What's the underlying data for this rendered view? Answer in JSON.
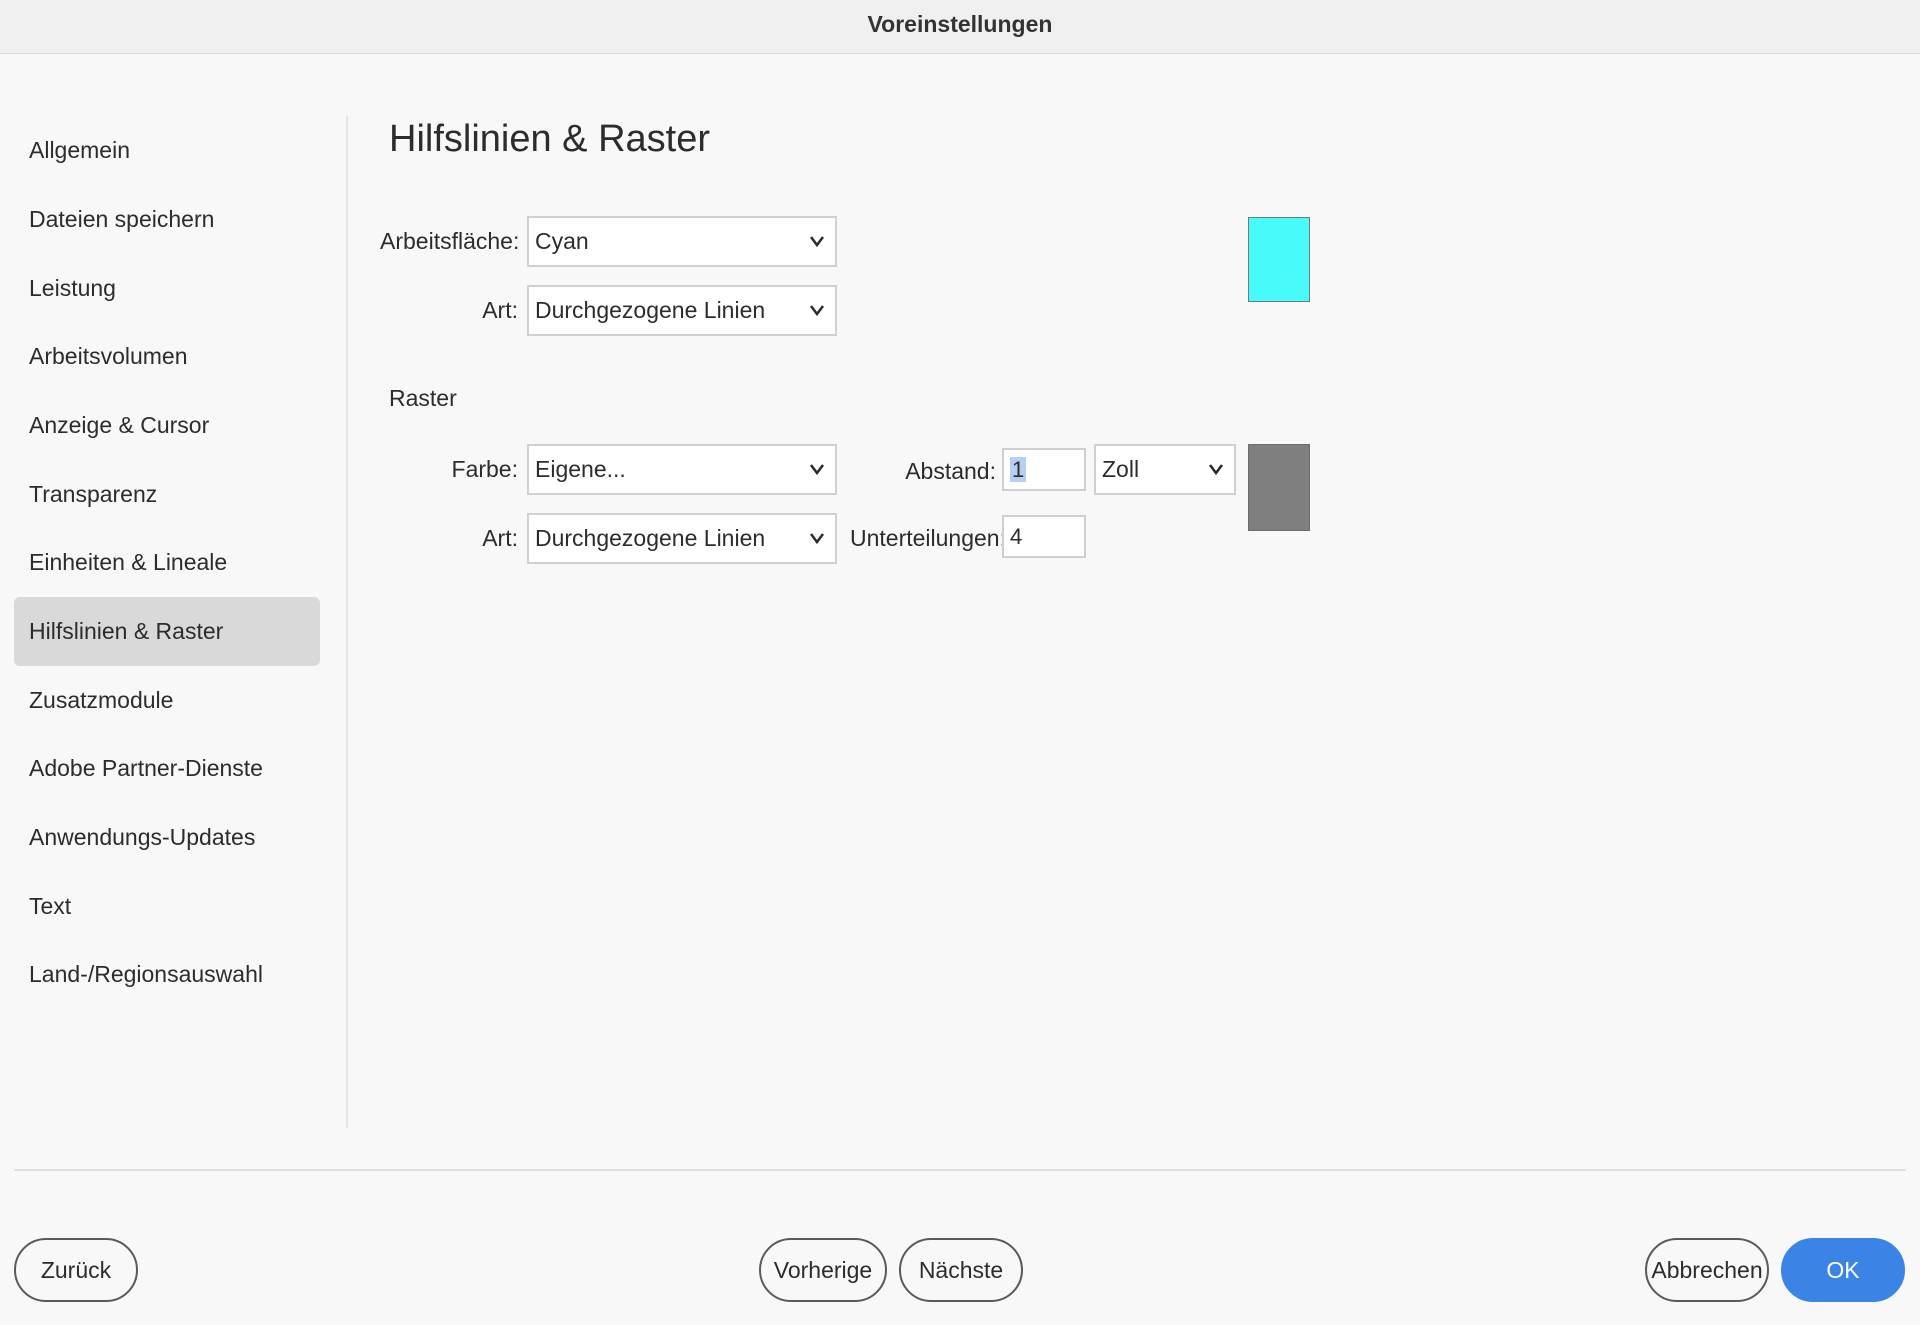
{
  "window": {
    "title": "Voreinstellungen"
  },
  "sidebar": {
    "items": [
      {
        "label": "Allgemein"
      },
      {
        "label": "Dateien speichern"
      },
      {
        "label": "Leistung"
      },
      {
        "label": "Arbeitsvolumen"
      },
      {
        "label": "Anzeige & Cursor"
      },
      {
        "label": "Transparenz"
      },
      {
        "label": "Einheiten & Lineale"
      },
      {
        "label": "Hilfslinien & Raster"
      },
      {
        "label": "Zusatzmodule"
      },
      {
        "label": "Adobe Partner-Dienste"
      },
      {
        "label": "Anwendungs-Updates"
      },
      {
        "label": "Text"
      },
      {
        "label": "Land-/Regionsauswahl"
      }
    ],
    "active_index": 7
  },
  "main": {
    "title": "Hilfslinien & Raster",
    "guides": {
      "color_label": "Arbeitsfläche:",
      "color_value": "Cyan",
      "style_label": "Art:",
      "style_value": "Durchgezogene Linien",
      "swatch_color": "#48fbfb"
    },
    "grid": {
      "section_label": "Raster",
      "color_label": "Farbe:",
      "color_value": "Eigene...",
      "style_label": "Art:",
      "style_value": "Durchgezogene Linien",
      "spacing_label": "Abstand:",
      "spacing_value": "1",
      "unit_value": "Zoll",
      "subdivisions_label": "Unterteilungen:",
      "subdivisions_value": "4",
      "swatch_color": "#7f7f7f"
    }
  },
  "footer": {
    "back_label": "Zurück",
    "previous_label": "Vorherige",
    "next_label": "Nächste",
    "cancel_label": "Abbrechen",
    "ok_label": "OK"
  }
}
